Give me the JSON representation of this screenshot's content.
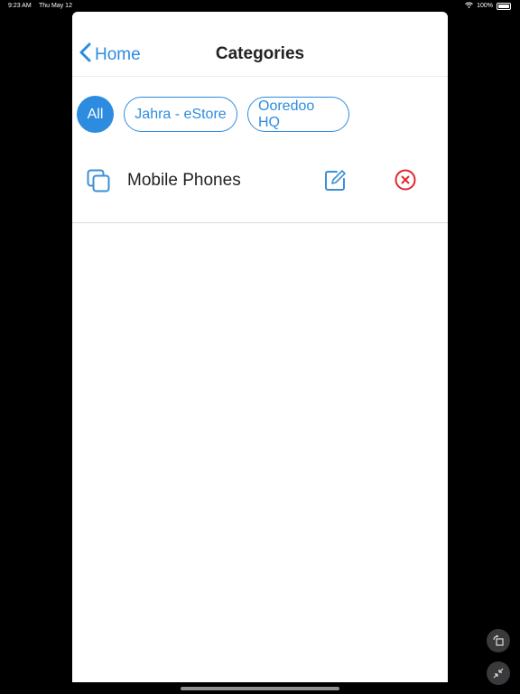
{
  "status_bar": {
    "time": "9:23 AM",
    "date": "Thu May 12",
    "battery": "100%"
  },
  "nav": {
    "back_label": "Home",
    "title": "Categories"
  },
  "filters": {
    "all": "All",
    "chips": [
      "Jahra - eStore",
      "Ooredoo HQ"
    ]
  },
  "categories": [
    {
      "name": "Mobile Phones"
    }
  ],
  "colors": {
    "accent": "#2d8cdf",
    "delete": "#e0282e"
  },
  "icons": {
    "back": "chevron-left-icon",
    "category": "copy-icon",
    "edit": "edit-icon",
    "delete": "close-circle-icon"
  }
}
